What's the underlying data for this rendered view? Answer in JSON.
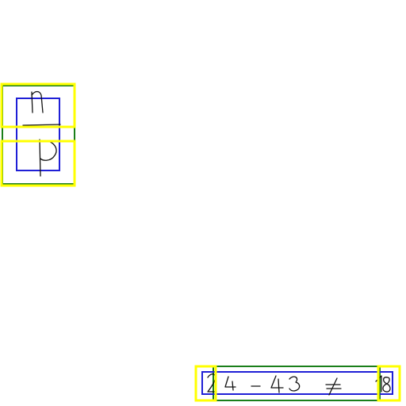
{
  "annotation_colors": {
    "outer": "#1a7f1a",
    "inner": "#1f1fd6",
    "token": "#ffff00",
    "ink": "#111111"
  },
  "fraction": {
    "numerator": "n",
    "denominator": "p"
  },
  "expression": {
    "text": "24 - 43 ≠ 18",
    "first_token": "2",
    "last_token": "8"
  }
}
